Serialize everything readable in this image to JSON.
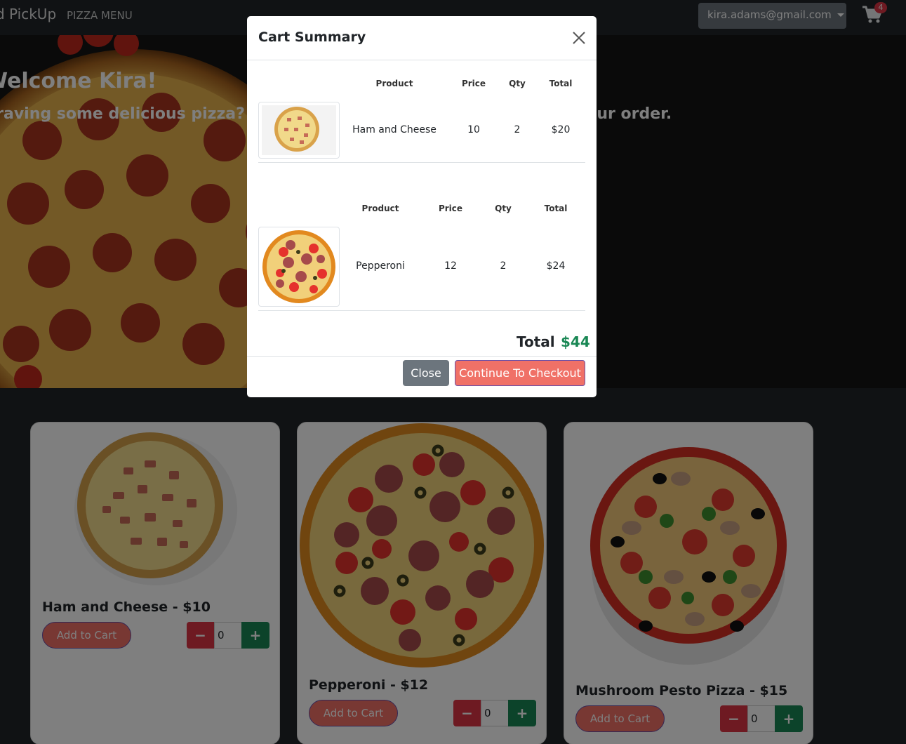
{
  "navbar": {
    "brand": "d PickUp",
    "menu_link": "PIZZA MENU",
    "user_email": "kira.adams@gmail.com",
    "cart_count": "4"
  },
  "hero": {
    "title": "Welcome Kira!",
    "subtitle": "Craving some delicious pizza? You've come to the right place. Start your order."
  },
  "products": [
    {
      "title": "Ham and Cheese - $10",
      "add_label": "Add to Cart",
      "qty": "0"
    },
    {
      "title": "Pepperoni - $12",
      "add_label": "Add to Cart",
      "qty": "0"
    },
    {
      "title": "Mushroom Pesto Pizza - $15",
      "add_label": "Add to Cart",
      "qty": "0"
    }
  ],
  "stepper": {
    "minus": "−",
    "plus": "+"
  },
  "modal": {
    "title": "Cart Summary",
    "headers": {
      "product": "Product",
      "price": "Price",
      "qty": "Qty",
      "total": "Total"
    },
    "items": [
      {
        "name": "Ham and Cheese",
        "price": "10",
        "qty": "2",
        "total": "$20"
      },
      {
        "name": "Pepperoni",
        "price": "12",
        "qty": "2",
        "total": "$24"
      }
    ],
    "total_label": "Total",
    "total_value": "$44",
    "close_label": "Close",
    "checkout_label": "Continue To Checkout"
  }
}
